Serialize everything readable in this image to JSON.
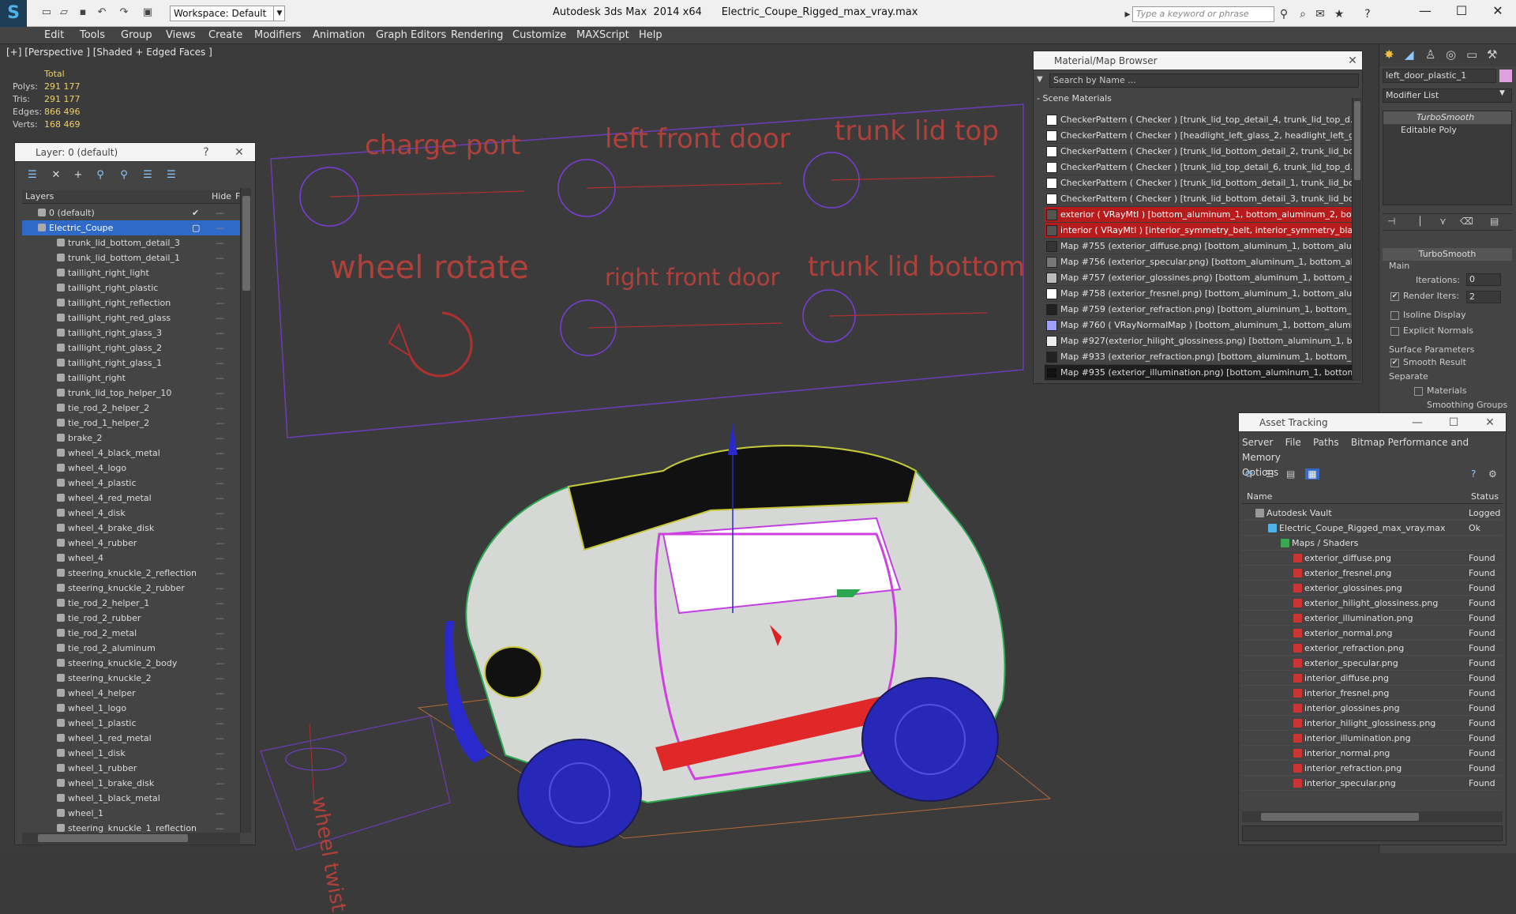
{
  "app": {
    "title": "Autodesk 3ds Max  2014 x64",
    "file": "Electric_Coupe_Rigged_max_vray.max",
    "workspace": "Workspace: Default",
    "search_placeholder": "Type a keyword or phrase"
  },
  "menus": [
    "Edit",
    "Tools",
    "Group",
    "Views",
    "Create",
    "Modifiers",
    "Animation",
    "Graph Editors",
    "Rendering",
    "Customize",
    "MAXScript",
    "Help"
  ],
  "viewport": {
    "label": "[+] [Perspective ] [Shaded + Edged Faces ]",
    "stats": {
      "header": "Total",
      "rows": [
        {
          "label": "Polys:",
          "value": "291 177"
        },
        {
          "label": "Tris:",
          "value": "291 177"
        },
        {
          "label": "Edges:",
          "value": "866 496"
        },
        {
          "label": "Verts:",
          "value": "168 469"
        }
      ]
    },
    "rig_labels": {
      "charge_port": "charge port",
      "left_front_door": "left front door",
      "trunk_lid_top": "trunk lid top",
      "wheel_rotate": "wheel rotate",
      "right_front_door": "right front door",
      "trunk_lid_bottom": "trunk lid bottom",
      "wheel_twist": "wheel twist"
    }
  },
  "layer_panel": {
    "title": "Layer: 0 (default)",
    "help": "?",
    "col_layers": "Layers",
    "col_hide": "Hide",
    "col_f": "F",
    "rows": [
      "0 (default)",
      "Electric_Coupe",
      "trunk_lid_bottom_detail_3",
      "trunk_lid_bottom_detail_1",
      "taillight_right_light",
      "taillight_right_plastic",
      "taillight_right_reflection",
      "taillight_right_red_glass",
      "taillight_right_glass_3",
      "taillight_right_glass_2",
      "taillight_right_glass_1",
      "taillight_right",
      "trunk_lid_top_helper_10",
      "tie_rod_2_helper_2",
      "tie_rod_1_helper_2",
      "brake_2",
      "wheel_4_black_metal",
      "wheel_4_logo",
      "wheel_4_plastic",
      "wheel_4_red_metal",
      "wheel_4_disk",
      "wheel_4_brake_disk",
      "wheel_4_rubber",
      "wheel_4",
      "steering_knuckle_2_reflection",
      "steering_knuckle_2_rubber",
      "tie_rod_2_helper_1",
      "tie_rod_2_rubber",
      "tie_rod_2_metal",
      "tie_rod_2_aluminum",
      "steering_knuckle_2_body",
      "steering_knuckle_2",
      "wheel_4_helper",
      "wheel_1_logo",
      "wheel_1_plastic",
      "wheel_1_red_metal",
      "wheel_1_disk",
      "wheel_1_rubber",
      "wheel_1_brake_disk",
      "wheel_1_black_metal",
      "wheel_1",
      "steering_knuckle_1_reflection"
    ]
  },
  "material_browser": {
    "title": "Material/Map Browser",
    "search": "Search by Name ...",
    "section": "- Scene Materials",
    "rows": [
      {
        "text": "CheckerPattern ( Checker ) [trunk_lid_top_detail_4, trunk_lid_top_d...",
        "style": "normal",
        "swatch": "#ffffff"
      },
      {
        "text": "CheckerPattern ( Checker ) [headlight_left_glass_2, headlight_left_gl...",
        "style": "normal",
        "swatch": "#ffffff"
      },
      {
        "text": "CheckerPattern ( Checker ) [trunk_lid_bottom_detail_2, trunk_lid_bo...",
        "style": "normal",
        "swatch": "#ffffff"
      },
      {
        "text": "CheckerPattern ( Checker ) [trunk_lid_top_detail_6, trunk_lid_top_d...",
        "style": "normal",
        "swatch": "#ffffff"
      },
      {
        "text": "CheckerPattern ( Checker ) [trunk_lid_bottom_detail_1, trunk_lid_bo...",
        "style": "normal",
        "swatch": "#ffffff"
      },
      {
        "text": "CheckerPattern ( Checker ) [trunk_lid_bottom_detail_3, trunk_lid_bo...",
        "style": "normal",
        "swatch": "#ffffff"
      },
      {
        "text": "exterior ( VRayMtl ) [bottom_aluminum_1, bottom_aluminum_2, bot...",
        "style": "red",
        "swatch": "#555555"
      },
      {
        "text": "interior ( VRayMtl ) [interior_symmetry_belt, interior_symmetry_blac...",
        "style": "red",
        "swatch": "#555555"
      },
      {
        "text": "Map #755 (exterior_diffuse.png) [bottom_aluminum_1, bottom_alum...",
        "style": "normal",
        "swatch": "#333333"
      },
      {
        "text": "Map #756 (exterior_specular.png) [bottom_aluminum_1, bottom_alu...",
        "style": "normal",
        "swatch": "#777777"
      },
      {
        "text": "Map #757 (exterior_glossines.png) [bottom_aluminum_1, bottom_al...",
        "style": "normal",
        "swatch": "#bbbbbb"
      },
      {
        "text": "Map #758 (exterior_fresnel.png) [bottom_aluminum_1, bottom_alum...",
        "style": "normal",
        "swatch": "#ffffff"
      },
      {
        "text": "Map #759 (exterior_refraction.png) [bottom_aluminum_1, bottom_al...",
        "style": "normal",
        "swatch": "#222222"
      },
      {
        "text": "Map #760 ( VRayNormalMap ) [bottom_aluminum_1, bottom_alumi...",
        "style": "normal",
        "swatch": "#9f9fff"
      },
      {
        "text": "Map #927(exterior_hilight_glossiness.png) [bottom_aluminum_1, bo...",
        "style": "normal",
        "swatch": "#eeeeee"
      },
      {
        "text": "Map #933 (exterior_refraction.png) [bottom_aluminum_1, bottom_al...",
        "style": "normal",
        "swatch": "#222222"
      },
      {
        "text": "Map #935 (exterior_illumination.png) [bottom_aluminum_1, bottom_...",
        "style": "dark",
        "swatch": "#111111"
      }
    ]
  },
  "asset_tracking": {
    "title": "Asset Tracking",
    "menus": [
      "Server",
      "File",
      "Paths",
      "Bitmap Performance and Memory",
      "Options"
    ],
    "col_name": "Name",
    "col_status": "Status",
    "rows": [
      {
        "name": "Autodesk Vault",
        "status": "Logged",
        "indent": 0,
        "kind": "vault"
      },
      {
        "name": "Electric_Coupe_Rigged_max_vray.max",
        "status": "Ok",
        "indent": 1,
        "kind": "max"
      },
      {
        "name": "Maps / Shaders",
        "status": "",
        "indent": 2,
        "kind": "folder"
      },
      {
        "name": "exterior_diffuse.png",
        "status": "Found",
        "indent": 3,
        "kind": "png"
      },
      {
        "name": "exterior_fresnel.png",
        "status": "Found",
        "indent": 3,
        "kind": "png"
      },
      {
        "name": "exterior_glossines.png",
        "status": "Found",
        "indent": 3,
        "kind": "png"
      },
      {
        "name": "exterior_hilight_glossiness.png",
        "status": "Found",
        "indent": 3,
        "kind": "png"
      },
      {
        "name": "exterior_illumination.png",
        "status": "Found",
        "indent": 3,
        "kind": "png"
      },
      {
        "name": "exterior_normal.png",
        "status": "Found",
        "indent": 3,
        "kind": "png"
      },
      {
        "name": "exterior_refraction.png",
        "status": "Found",
        "indent": 3,
        "kind": "png"
      },
      {
        "name": "exterior_specular.png",
        "status": "Found",
        "indent": 3,
        "kind": "png"
      },
      {
        "name": "interior_diffuse.png",
        "status": "Found",
        "indent": 3,
        "kind": "png"
      },
      {
        "name": "interior_fresnel.png",
        "status": "Found",
        "indent": 3,
        "kind": "png"
      },
      {
        "name": "interior_glossines.png",
        "status": "Found",
        "indent": 3,
        "kind": "png"
      },
      {
        "name": "interior_hilight_glossiness.png",
        "status": "Found",
        "indent": 3,
        "kind": "png"
      },
      {
        "name": "interior_illumination.png",
        "status": "Found",
        "indent": 3,
        "kind": "png"
      },
      {
        "name": "interior_normal.png",
        "status": "Found",
        "indent": 3,
        "kind": "png"
      },
      {
        "name": "interior_refraction.png",
        "status": "Found",
        "indent": 3,
        "kind": "png"
      },
      {
        "name": "interior_specular.png",
        "status": "Found",
        "indent": 3,
        "kind": "png"
      }
    ]
  },
  "command_panel": {
    "object_name": "left_door_plastic_1",
    "modifier_list": "Modifier List",
    "stack": [
      "TurboSmooth",
      "Editable Poly"
    ],
    "rollout": "TurboSmooth",
    "main": "Main",
    "iterations_label": "Iterations:",
    "iterations": "0",
    "render_iters_label": "Render Iters:",
    "render_iters": "2",
    "isoline": "Isoline Display",
    "explicit": "Explicit Normals",
    "surface_params": "Surface Parameters",
    "smooth_result": "Smooth Result",
    "separate": "Separate",
    "materials": "Materials",
    "smoothing_groups": "Smoothing Groups"
  }
}
